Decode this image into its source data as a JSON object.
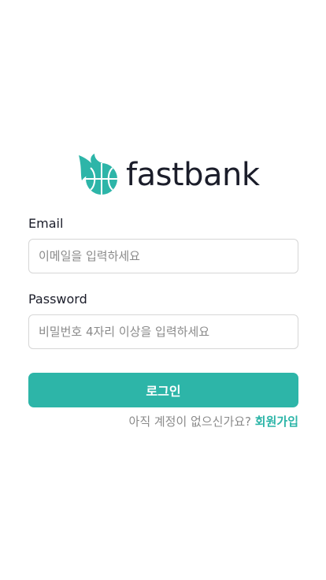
{
  "brand": {
    "name": "fastbank",
    "logo_icon": "basketball-flame-icon",
    "accent_color": "#2db5a8",
    "text_color": "#1b1d2a"
  },
  "form": {
    "email_label": "Email",
    "email_placeholder": "이메일을 입력하세요",
    "email_value": "",
    "password_label": "Password",
    "password_placeholder": "비밀번호 4자리 이상을 입력하세요",
    "password_value": "",
    "login_button": "로그인"
  },
  "signup": {
    "prompt": "아직 계정이 없으신가요?",
    "link_label": "회원가입"
  }
}
